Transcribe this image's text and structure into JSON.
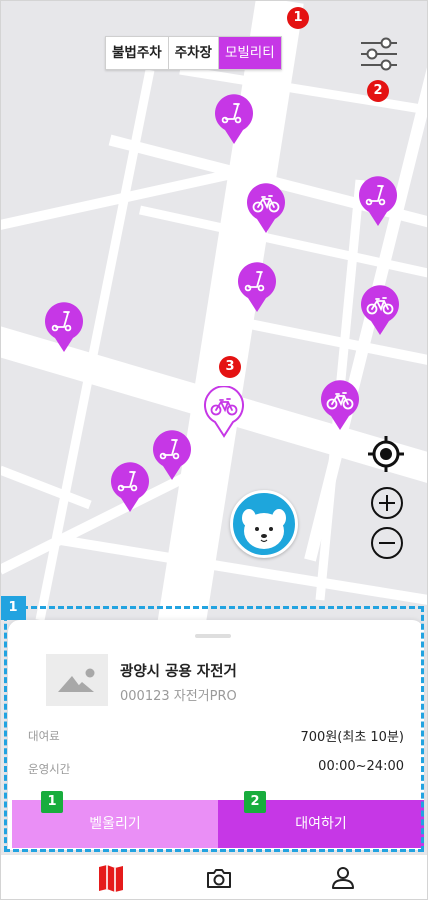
{
  "map": {
    "background": "#e7e7ea",
    "road_color": "#ffffff"
  },
  "filter_tabs": [
    {
      "label": "불법주차",
      "active": false
    },
    {
      "label": "주차장",
      "active": false
    },
    {
      "label": "모빌리티",
      "active": true
    }
  ],
  "accent_color": "#c637e6",
  "annotations": {
    "top_badge_1": "1",
    "top_badge_2": "2",
    "top_badge_3": "3",
    "panel_badge": "1",
    "btn_badge_1": "1",
    "btn_badge_2": "2"
  },
  "map_pins": [
    {
      "type": "kickboard",
      "selected": false
    },
    {
      "type": "bicycle",
      "selected": false
    },
    {
      "type": "kickboard",
      "selected": false
    },
    {
      "type": "kickboard",
      "selected": false
    },
    {
      "type": "bicycle",
      "selected": false
    },
    {
      "type": "kickboard",
      "selected": false
    },
    {
      "type": "bicycle",
      "selected": true
    },
    {
      "type": "bicycle",
      "selected": false
    },
    {
      "type": "kickboard",
      "selected": false
    },
    {
      "type": "kickboard",
      "selected": false
    }
  ],
  "map_controls": [
    "locate-icon",
    "zoom-in-icon",
    "zoom-out-icon"
  ],
  "detail": {
    "title": "광양시 공용 자전거",
    "subtitle": "000123 자전거PRO",
    "fee_label": "대여료",
    "fee_value": "700원(최초 10분)",
    "hours_label": "운영시간",
    "hours_value": "00:00~24:00",
    "ring_button": "벨울리기",
    "rent_button": "대여하기"
  },
  "tabbar": [
    "map-icon",
    "camera-icon",
    "profile-icon"
  ]
}
